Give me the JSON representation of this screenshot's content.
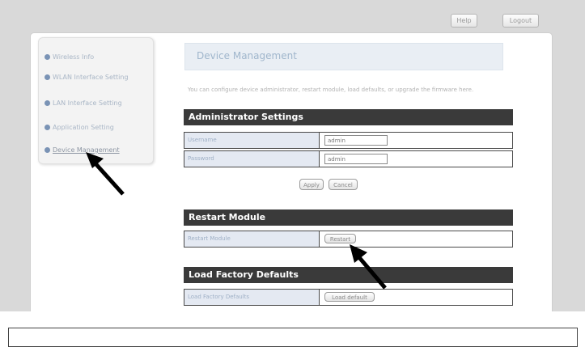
{
  "header": {
    "help_label": "Help",
    "logout_label": "Logout"
  },
  "sidebar": {
    "items": [
      {
        "label": "Wireless Info"
      },
      {
        "label": "WLAN Interface Setting"
      },
      {
        "label": "LAN Interface Setting"
      },
      {
        "label": "Application Setting"
      },
      {
        "label": "Device Management"
      }
    ]
  },
  "main": {
    "title": "Device Management",
    "description": "You can configure device administrator, restart module, load defaults, or upgrade the firmware here."
  },
  "admin": {
    "section_title": "Administrator Settings",
    "username_label": "Username",
    "username_value": "admin",
    "password_label": "Password",
    "password_value": "admin",
    "apply_label": "Apply",
    "cancel_label": "Cancel"
  },
  "restart": {
    "section_title": "Restart Module",
    "row_label": "Restart Module",
    "button_label": "Restart"
  },
  "factory": {
    "section_title": "Load Factory Defaults",
    "row_label": "Load Factory Defaults",
    "button_label": "Load default"
  },
  "colors": {
    "section_header": "#3a3a3a",
    "label_cell": "#e4e9f2",
    "title_bar": "#e9eef4",
    "arrow": "#000000"
  },
  "icons": [
    "bullet-icon",
    "pointer-arrow-icon"
  ]
}
